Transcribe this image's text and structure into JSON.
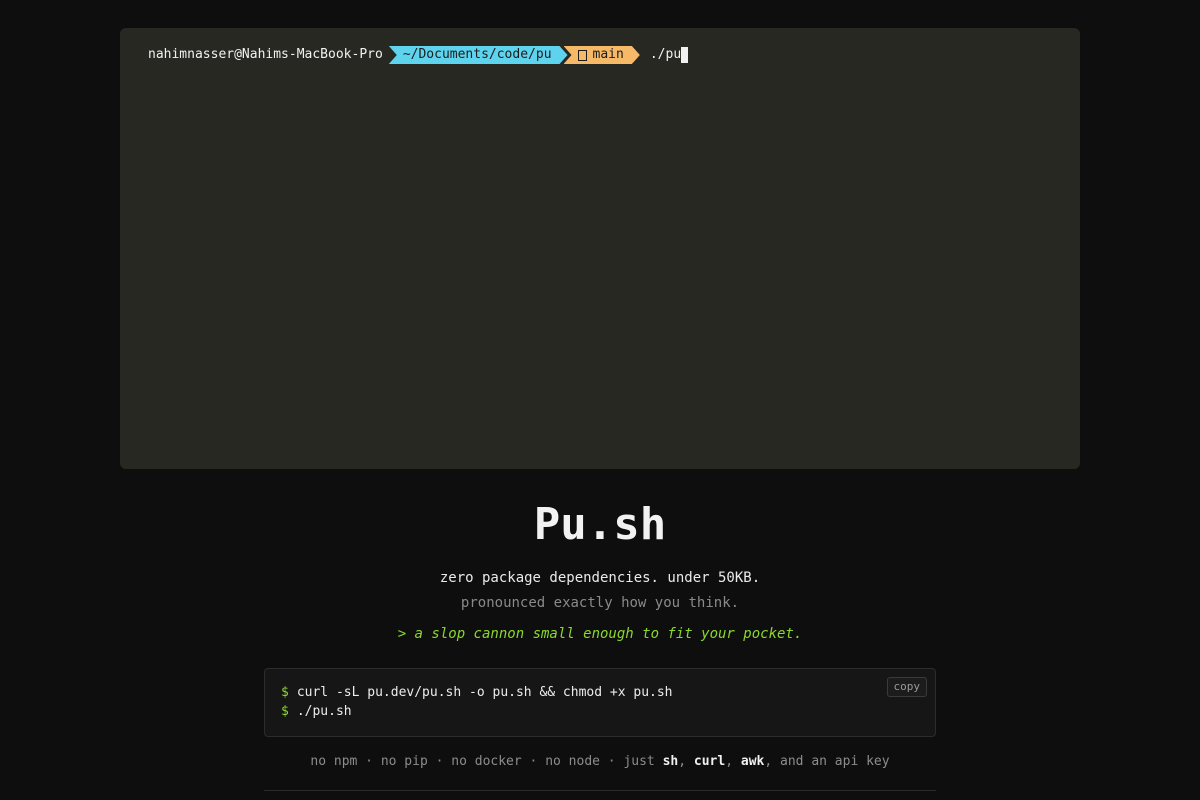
{
  "terminal": {
    "user_host": "nahimnasser@Nahims-MacBook-Pro",
    "path": "~/Documents/code/pu",
    "branch_icon": "git-branch-icon",
    "branch": "main",
    "command": "./pu"
  },
  "hero": {
    "title": "Pu.sh",
    "tagline": "zero package dependencies. under 50KB.",
    "pronounced": "pronounced exactly how you think.",
    "slogan": "> a slop cannon small enough to fit your pocket."
  },
  "install": {
    "prompt_symbol": "$",
    "line1": "curl -sL pu.dev/pu.sh -o pu.sh && chmod +x pu.sh",
    "line2": "./pu.sh",
    "copy_label": "copy"
  },
  "deps": {
    "prefix": "no npm · no pip · no docker · no node · just ",
    "tool1": "sh",
    "sep1": ", ",
    "tool2": "curl",
    "sep2": ", ",
    "tool3": "awk",
    "suffix": ", and an api key"
  },
  "colors": {
    "background": "#0e0e0e",
    "terminal_bg": "#282823",
    "path_segment": "#5ed3ee",
    "git_segment": "#f6b968",
    "accent_green": "#8ad82f"
  }
}
